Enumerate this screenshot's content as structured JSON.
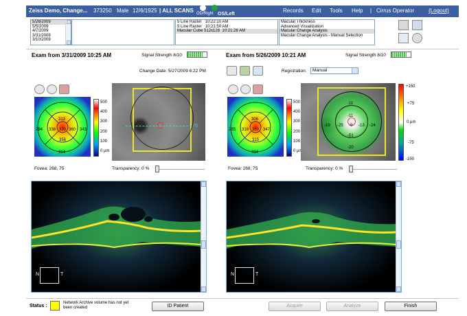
{
  "header": {
    "title": "Zeiss Demo, Change...",
    "patient_id": "373250",
    "sex": "Male",
    "dob": "12/6/1925",
    "scan_filter": "| ALL SCANS",
    "eye_right": "OD/Right",
    "eye_left": "OS/Left",
    "menu": [
      "Records",
      "Edit",
      "Tools",
      "Help"
    ],
    "operator": "Cirrus Operator",
    "logout": "(Logout)"
  },
  "dates": [
    "5/26/2009",
    "5/5/2009",
    "4/7/2009",
    "3/31/2009",
    "3/10/2009"
  ],
  "scans": [
    {
      "name": "5 Line Raster",
      "time": "10:22:10 AM"
    },
    {
      "name": "5 Line Raster",
      "time": "10:21:50 AM"
    },
    {
      "name": "Macular Cube 512x128",
      "time": "10:21:28 AM"
    }
  ],
  "analyses": [
    "Macular Thickness",
    "Advanced Visualization",
    "Macular Change Analysis",
    "Macular Change Analysis - Manual Selection"
  ],
  "left_exam": {
    "title": "Exam from 3/31/2009 10:25 AM",
    "signal_label": "Signal Strength 8/10",
    "signal_fraction": 0.8,
    "fovea": "Fovea:  268, 75",
    "transparency": "Transparency:  0 %",
    "map_values": [
      "294",
      "313",
      "338",
      "339",
      "360",
      "343",
      "356",
      "316",
      "314"
    ],
    "scale_ticks": [
      "500",
      "400",
      "300",
      "200",
      "100",
      "0 µm"
    ],
    "fundus_marker": "75"
  },
  "change_date": "Change Date:  5/27/2009 6:22 PM",
  "right_exam": {
    "title": "Exam from 5/26/2009 10:21 AM",
    "signal_label": "Signal Strength 8/10",
    "signal_fraction": 0.8,
    "registration_label": "Registration:",
    "registration_value": "Manual",
    "fovea": "Fovea:  268, 75",
    "transparency": "Transparency:  0 %",
    "map_values": [
      "285",
      "306",
      "318",
      "360",
      "347",
      "315",
      "314"
    ],
    "scale_ticks": [
      "500",
      "400",
      "300",
      "200",
      "100",
      "0 µm"
    ],
    "diff_values": [
      "-11",
      "-19",
      "-25",
      "-11",
      "-9",
      "-13",
      "-24",
      "-51",
      "-20"
    ],
    "diff_scale": [
      "+150",
      "+75",
      "0 µm",
      "-75",
      "-150"
    ],
    "fundus_marker": "75"
  },
  "orientation": {
    "n": "N",
    "t": "T"
  },
  "status": {
    "label": "Status :",
    "message": "Network Archive volume has not yet been created",
    "color": "#ffff00"
  },
  "buttons": {
    "id_patient": "ID Patient",
    "acquire": "Acquire",
    "analyze": "Analyze",
    "finish": "Finish"
  }
}
